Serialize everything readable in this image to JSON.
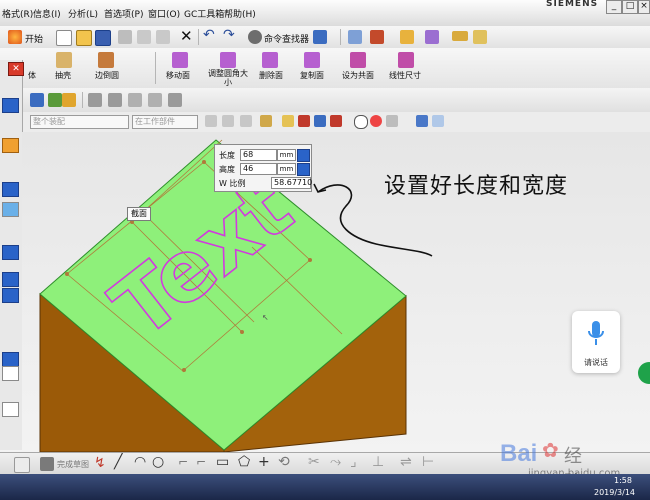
{
  "menu": {
    "items": [
      "格式(R)",
      "信息(I)",
      "分析(L)",
      "首选项(P)",
      "窗口(O)",
      "GC工具箱",
      "帮助(H)"
    ],
    "brand": "SIEMENS"
  },
  "toolbar1": {
    "start_label": "开始",
    "command_finder_label": "命令查找器"
  },
  "toolbar2": {
    "buttons": [
      "抽壳",
      "边倒圆",
      "移动面",
      "调整圆角大小",
      "删除面",
      "复制面",
      "设为共面",
      "线性尺寸"
    ],
    "partial_label": "体"
  },
  "toolbar4": {
    "select_filter_1": "整个装配",
    "select_filter_2": "在工作部件"
  },
  "param_dialog": {
    "length_label": "长度",
    "length_value": "68",
    "height_label": "高度",
    "height_value": "46",
    "ratio_label": "W 比例",
    "ratio_value": "58.67710",
    "unit": "mm"
  },
  "section_tag": "截面",
  "model_text": "Text",
  "annotation": "设置好长度和宽度",
  "voice_widget": {
    "label": "请说话"
  },
  "bottombar": {
    "sketch_label": "完成草图"
  },
  "taskbar": {
    "time": "1:58",
    "date": "2019/3/14"
  },
  "watermark": {
    "brand": "Bai",
    "brand2": "经验",
    "url": "jingyan.baidu.com"
  },
  "colors": {
    "top_face": "#8ef07a",
    "front_face": "#9b5a08",
    "side_face": "#a3620c",
    "text_outline": "#d23adf",
    "dim_line": "#b07a3a"
  }
}
